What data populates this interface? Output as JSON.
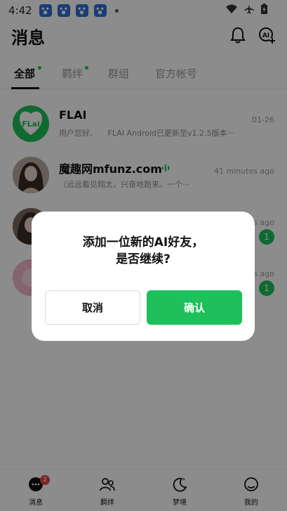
{
  "status_bar": {
    "time": "4:42"
  },
  "header": {
    "title": "消息"
  },
  "tabs": [
    {
      "label": "全部",
      "dot": true
    },
    {
      "label": "羁绊",
      "dot": true
    },
    {
      "label": "群组",
      "dot": false
    },
    {
      "label": "官方帐号",
      "dot": false
    }
  ],
  "conversations": [
    {
      "name": "FLAI",
      "preview": "用户您好,　　FLAI Android已更新至v1.2.5版本···",
      "time": "01-26",
      "avatar_text": "FLai"
    },
    {
      "name": "魔趣网mfunz.com",
      "preview": "（远远看见翔太，兴奋地跑来。一个···",
      "time": "41 minutes ago"
    },
    {
      "name": "",
      "preview": "",
      "time": "s ago",
      "badge": "1"
    },
    {
      "name": "",
      "preview": "",
      "time": "s ago",
      "badge": "1"
    }
  ],
  "dialog": {
    "message_line1": "添加一位新的AI好友，",
    "message_line2": "是否继续?",
    "cancel_label": "取消",
    "confirm_label": "确认"
  },
  "tabbar": {
    "items": [
      {
        "label": "消息",
        "badge": "2"
      },
      {
        "label": "羁绊"
      },
      {
        "label": "梦境"
      },
      {
        "label": "我的"
      }
    ]
  },
  "colors": {
    "accent": "#1fc05c",
    "badge_red": "#e04545"
  }
}
